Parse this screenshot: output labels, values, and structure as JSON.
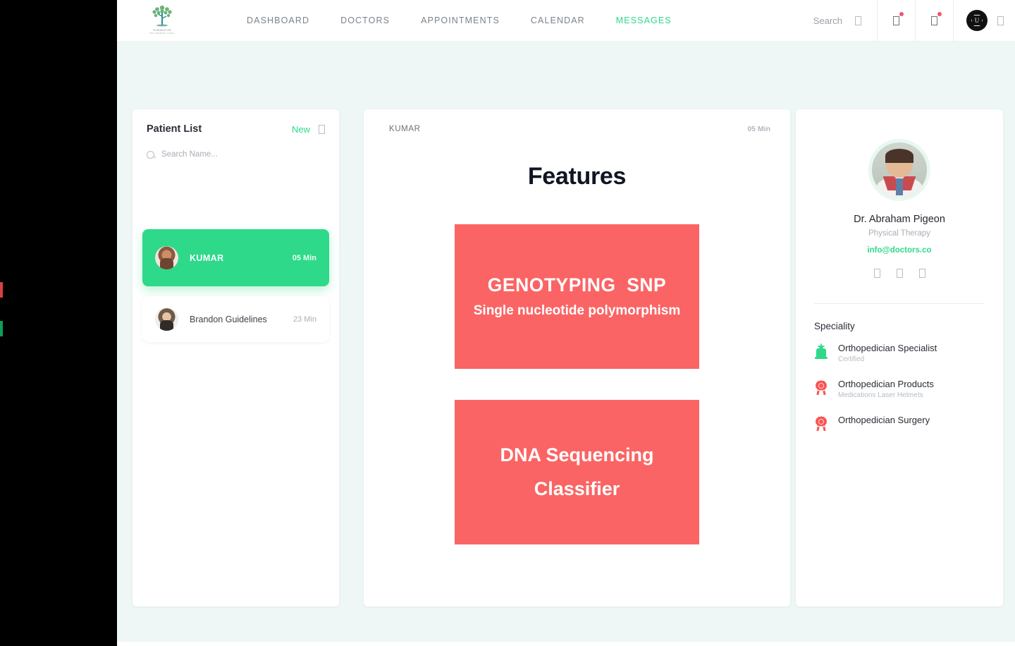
{
  "brand": {
    "logo_icon": "tree-logo-icon",
    "logo_caption_line1": "SCIENCE PK",
    "logo_caption_line2": "PET GENOMIC CLINIC"
  },
  "nav": {
    "links": [
      {
        "label": "DASHBOARD",
        "active": false
      },
      {
        "label": "DOCTORS",
        "active": false
      },
      {
        "label": "APPOINTMENTS",
        "active": false
      },
      {
        "label": "CALENDAR",
        "active": false
      },
      {
        "label": "MESSAGES",
        "active": true
      }
    ],
    "search_label": "Search",
    "search_icon": "search-icon",
    "notification_icon": "bell-notification-icon",
    "message_icon": "envelope-notification-icon",
    "avatar_icon": "user-avatar-icon",
    "chevron_icon": "chevron-down-icon"
  },
  "patient_list": {
    "title": "Patient List",
    "new_label": "New",
    "new_icon": "plus-icon",
    "search_placeholder": "Search Name...",
    "search_value": "",
    "items": [
      {
        "name": "KUMAR",
        "time": "05 Min",
        "active": true
      },
      {
        "name": "Brandon Guidelines",
        "time": "23 Min",
        "active": false
      }
    ]
  },
  "conversation": {
    "header_name": "KUMAR",
    "header_time": "05 Min",
    "title": "Features",
    "slides": [
      {
        "title": "GENOTYPING  SNP",
        "subtitle": "Single nucleotide polymorphism"
      },
      {
        "title_line1": "DNA Sequencing",
        "title_line2": "Classifier"
      }
    ]
  },
  "doctor": {
    "name": "Dr. Abraham Pigeon",
    "role": "Physical Therapy",
    "email": "info@doctors.co",
    "social": [
      "facebook-icon",
      "twitter-icon",
      "linkedin-icon"
    ],
    "speciality_title": "Speciality",
    "specialities": [
      {
        "title": "Orthopedician Specialist",
        "subtitle": "Certified",
        "icon": "trophy-award-icon"
      },
      {
        "title": "Orthopedician Products",
        "subtitle": "Medications Laser Helmets",
        "icon": "medal-badge-icon"
      },
      {
        "title": "Orthopedician Surgery",
        "subtitle": "",
        "icon": "medal-badge-icon"
      }
    ]
  },
  "colors": {
    "accent_green": "#2ed98a",
    "slide_red": "#fb6464",
    "page_background": "#eef7f5",
    "badge_red": "#f0556d"
  }
}
